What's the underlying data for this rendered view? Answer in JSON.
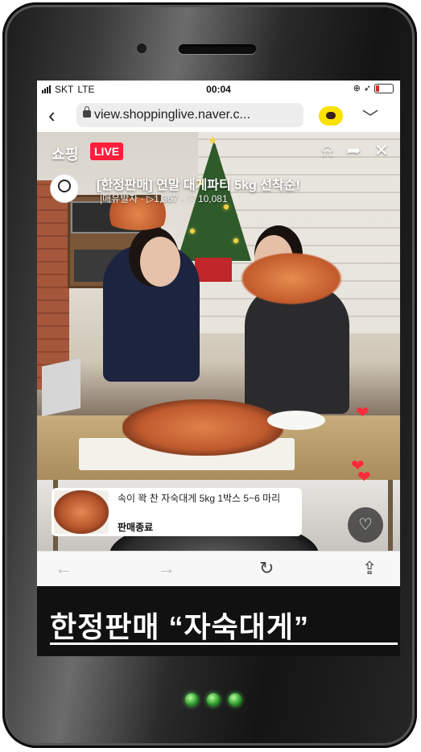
{
  "status_bar": {
    "carrier": "SKT",
    "network": "LTE",
    "time": "00:04"
  },
  "browser": {
    "url": "view.shoppinglive.naver.c...",
    "back_icon": "chevron-left-icon",
    "more_icon": "chevron-down-icon"
  },
  "live": {
    "brand": "쇼핑",
    "badge": "LIVE",
    "title": "[한정판매] 연말 대게파티 5kg 선착순!",
    "meta": "|매유발자 · ▷1,367 · ♡ 10,081"
  },
  "product": {
    "name": "속이 꽉 찬 자숙대게 5kg 1박스 5~6 마리",
    "status": "판매종료"
  },
  "caption": "한정판매 “자숙대게”",
  "colors": {
    "live_red": "#ff1e3c",
    "kakao_yellow": "#fae100",
    "led_green": "#56d65a"
  }
}
